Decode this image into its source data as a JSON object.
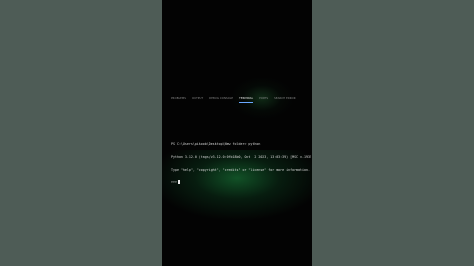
{
  "panel": {
    "tabs": [
      "PROBLEMS",
      "OUTPUT",
      "DEBUG CONSOLE",
      "TERMINAL",
      "PORTS",
      "SEARCH ERROR"
    ],
    "active_tab": "TERMINAL"
  },
  "terminal": {
    "lines": [
      "PS C:\\Users\\pikoob\\Desktop\\New folder> python",
      "Python 3.12.0 (tags/v3.12.0:0fb18b0, Oct  2 2023, 13:03:39) [MSC v.1935",
      "Type \"help\", \"copyright\", \"credits\" or \"license\" for more information."
    ],
    "prompt": ">>>"
  },
  "colors": {
    "backdrop": "#4d5b55",
    "video": "#030303",
    "glow": "#145f2d",
    "tab_accent": "#6aa8ff"
  }
}
